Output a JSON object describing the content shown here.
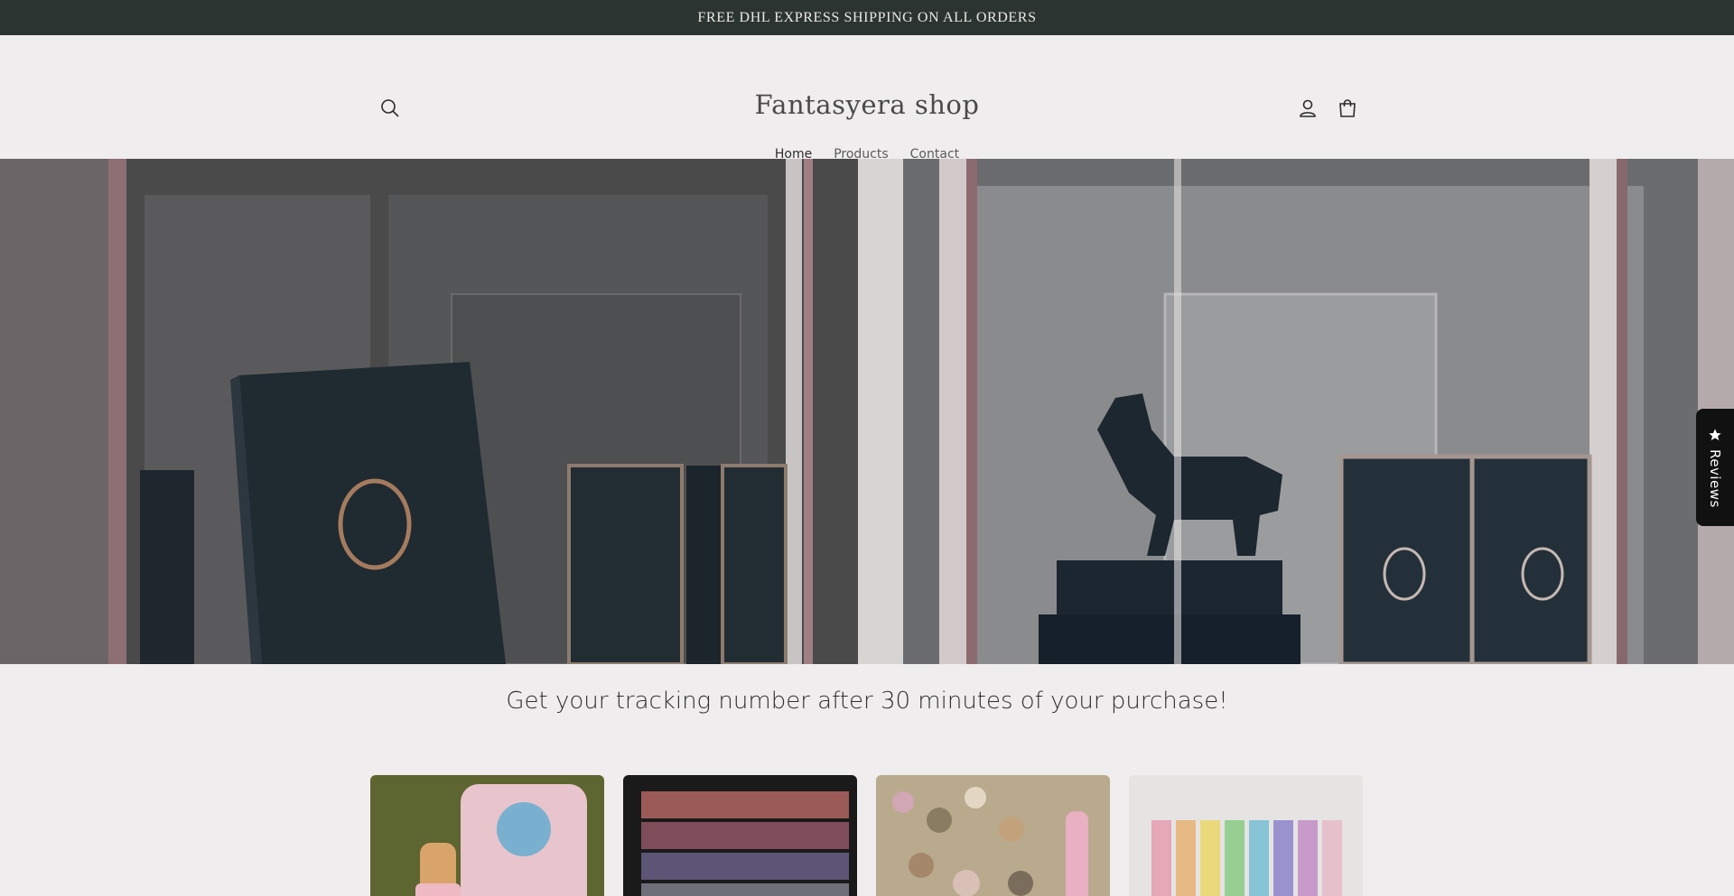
{
  "announcement": {
    "text": "FREE DHL EXPRESS SHIPPING ON ALL ORDERS"
  },
  "header": {
    "logo": "Fantasyera shop",
    "nav": [
      {
        "label": "Home",
        "active": true
      },
      {
        "label": "Products",
        "active": false
      },
      {
        "label": "Contact",
        "active": false
      }
    ],
    "icons": [
      "search-icon",
      "account-icon",
      "cart-icon"
    ]
  },
  "tracking_message": "Get your tracking number after 30 minutes of your purchase!",
  "reviews_tab": {
    "label": "Reviews",
    "icon": "star-icon"
  },
  "colors": {
    "announcement_bg": "#2c3431",
    "page_bg": "#f0edee",
    "reviews_tab_bg": "#111111"
  }
}
